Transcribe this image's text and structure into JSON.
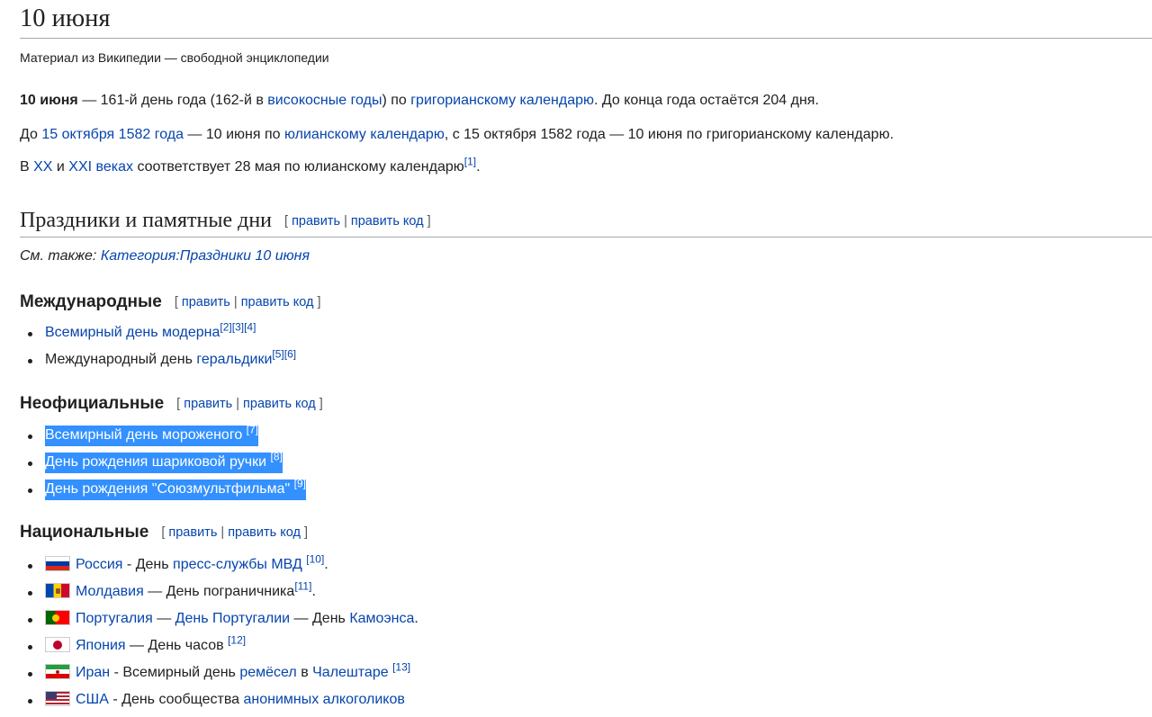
{
  "title": "10 июня",
  "sitesub": "Материал из Википедии — свободной энциклопедии",
  "intro": {
    "p1": {
      "bold": "10 июня",
      "t1": " — 161-й день года (162-й в ",
      "l1": "високосные годы",
      "t2": ") по ",
      "l2": "григорианскому календарю",
      "t3": ". До конца года остаётся 204 дня."
    },
    "p2": {
      "t0": "До ",
      "l1": "15 октября 1582 года",
      "t1": " — 10 июня по ",
      "l2": "юлианскому календарю",
      "t2": ", с 15 октября 1582 года — 10 июня по григорианскому календарю."
    },
    "p3": {
      "t0": "В ",
      "l1": "XX",
      "t1": " и ",
      "l2": "XXI веках",
      "t2": " соответствует 28 мая по юлианскому календарю",
      "ref": "[1]",
      "t3": "."
    }
  },
  "edit": {
    "open": "[ ",
    "edit": "править",
    "sep": " | ",
    "edit_code": "править код",
    "close": " ]"
  },
  "section": {
    "title": "Праздники и памятные дни",
    "seealso_label": "См. также: ",
    "seealso_link": "Категория:Праздники 10 июня"
  },
  "international": {
    "title": "Международные",
    "items": [
      {
        "link": "Всемирный день модерна",
        "refs": "[2][3][4]"
      },
      {
        "text": "Международный день ",
        "link": "геральдики",
        "refs": "[5][6]"
      }
    ]
  },
  "unofficial": {
    "title": "Неофициальные",
    "items": [
      {
        "link": "Всемирный день мороженого",
        "ref": "[7]"
      },
      {
        "link": "День рождения шариковой ручки",
        "ref": "[8]"
      },
      {
        "link": "День рождения \"Союзмультфильма\"",
        "ref": "[9]"
      }
    ]
  },
  "national": {
    "title": "Национальные",
    "items": [
      {
        "flag": "russia-flag-icon",
        "country": "Россия",
        "t1": " - День ",
        "l1": "пресс-службы МВД",
        "ref": "[10]",
        "t2": "."
      },
      {
        "flag": "moldova-flag-icon",
        "country": "Молдавия",
        "t1": " — День пограничника",
        "ref": "[11]",
        "t2": "."
      },
      {
        "flag": "portugal-flag-icon",
        "country": "Португалия",
        "t1": " — ",
        "l1": "День Португалии",
        "t2": " — День ",
        "l2": "Камоэнса",
        "t3": "."
      },
      {
        "flag": "japan-flag-icon",
        "country": "Япония",
        "t1": " — День часов ",
        "ref": "[12]"
      },
      {
        "flag": "iran-flag-icon",
        "country": "Иран",
        "t1": " - Всемирный день ",
        "l1": "ремёсел",
        "t2": " в ",
        "l2": "Чалештаре",
        "ref": "[13]"
      },
      {
        "flag": "usa-flag-icon",
        "country": "США",
        "t1": " - День сообщества ",
        "l1": "анонимных алкоголиков"
      }
    ]
  },
  "colors": {
    "link": "#0645ad",
    "selection": "#3390ff",
    "text": "#202122",
    "border": "#a2a9b1"
  }
}
